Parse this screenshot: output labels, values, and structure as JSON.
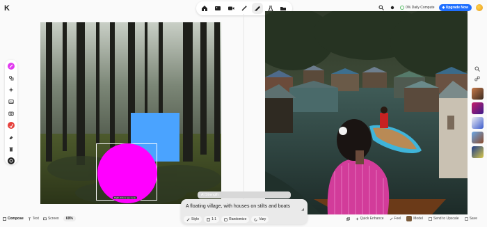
{
  "brand": {
    "logo": "K"
  },
  "topnav": {
    "items": [
      {
        "name": "home-icon"
      },
      {
        "name": "image-icon"
      },
      {
        "name": "video-icon"
      },
      {
        "name": "edit-icon"
      },
      {
        "name": "realtime-canvas-icon",
        "active": true
      },
      {
        "name": "train-icon"
      },
      {
        "name": "folder-icon"
      }
    ]
  },
  "topright": {
    "compute_label": "0% Daily Compute",
    "upgrade_label": "Upgrade Now"
  },
  "canvas": {
    "shapes": {
      "square_color": "#4aa3ff",
      "circle_color": "#ff00ff",
      "label": "Right-click to see menu"
    }
  },
  "prompt": {
    "strength_label": "AI Strength",
    "text": "A floating village, with houses on stilts and boats zigzagging between",
    "style_label": "Style",
    "ratio_label": "1:1",
    "randomize_label": "Randomize",
    "vary_label": "Vary"
  },
  "bottom": {
    "modes": [
      "Compose",
      "Text",
      "Screen"
    ],
    "zoom": "69%",
    "actions": [
      "Quick Enhance",
      "Feel",
      "Model",
      "Send to Upscale",
      "Save"
    ]
  },
  "colors": {
    "accent": "#1f6fff",
    "pink": "#e13bf0"
  }
}
